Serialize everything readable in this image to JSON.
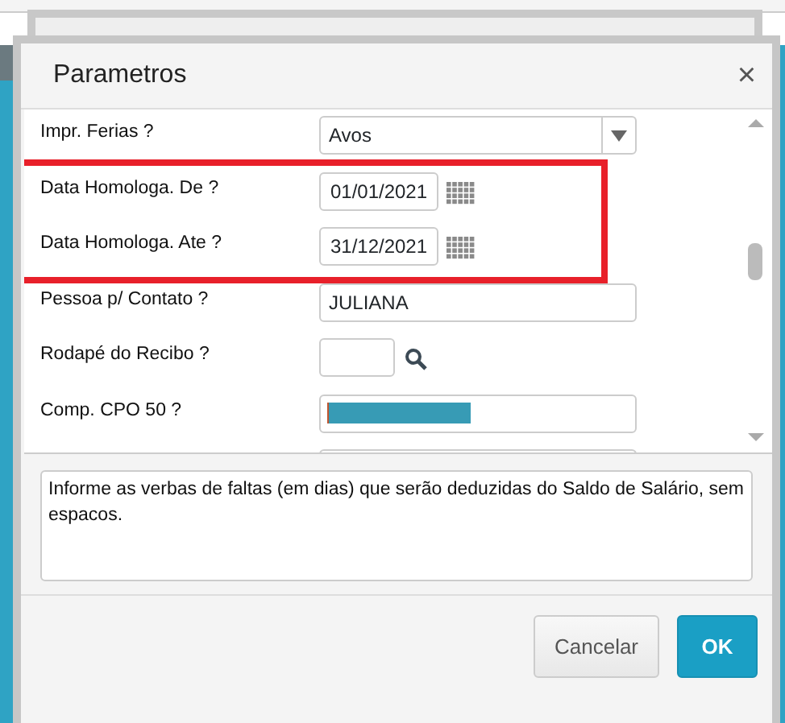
{
  "dialog": {
    "title": "Parametros",
    "close": "×"
  },
  "fields": [
    {
      "kind": "combo",
      "label": "Impr. Ferias ?",
      "value": "Avos",
      "highlighted": false
    },
    {
      "kind": "date",
      "label": "Data Homologa. De ?",
      "value": "01/01/2021",
      "highlighted": true
    },
    {
      "kind": "date",
      "label": "Data Homologa. Ate ?",
      "value": "31/12/2021",
      "highlighted": true
    },
    {
      "kind": "text",
      "label": "Pessoa p/ Contato ?",
      "value": "JULIANA",
      "highlighted": false
    },
    {
      "kind": "lookup",
      "label": "Rodapé do Recibo ?",
      "highlighted": false
    },
    {
      "kind": "selected",
      "label": "Comp. CPO 50 ?",
      "highlighted": false
    },
    {
      "kind": "clipped",
      "highlighted": false
    }
  ],
  "help": "Informe as verbas de faltas (em dias) que serão deduzidas do Saldo de Salário, sem espacos.",
  "buttons": [
    {
      "label": "Cancelar",
      "kind": "secondary"
    },
    {
      "label": "OK",
      "kind": "primary"
    }
  ]
}
